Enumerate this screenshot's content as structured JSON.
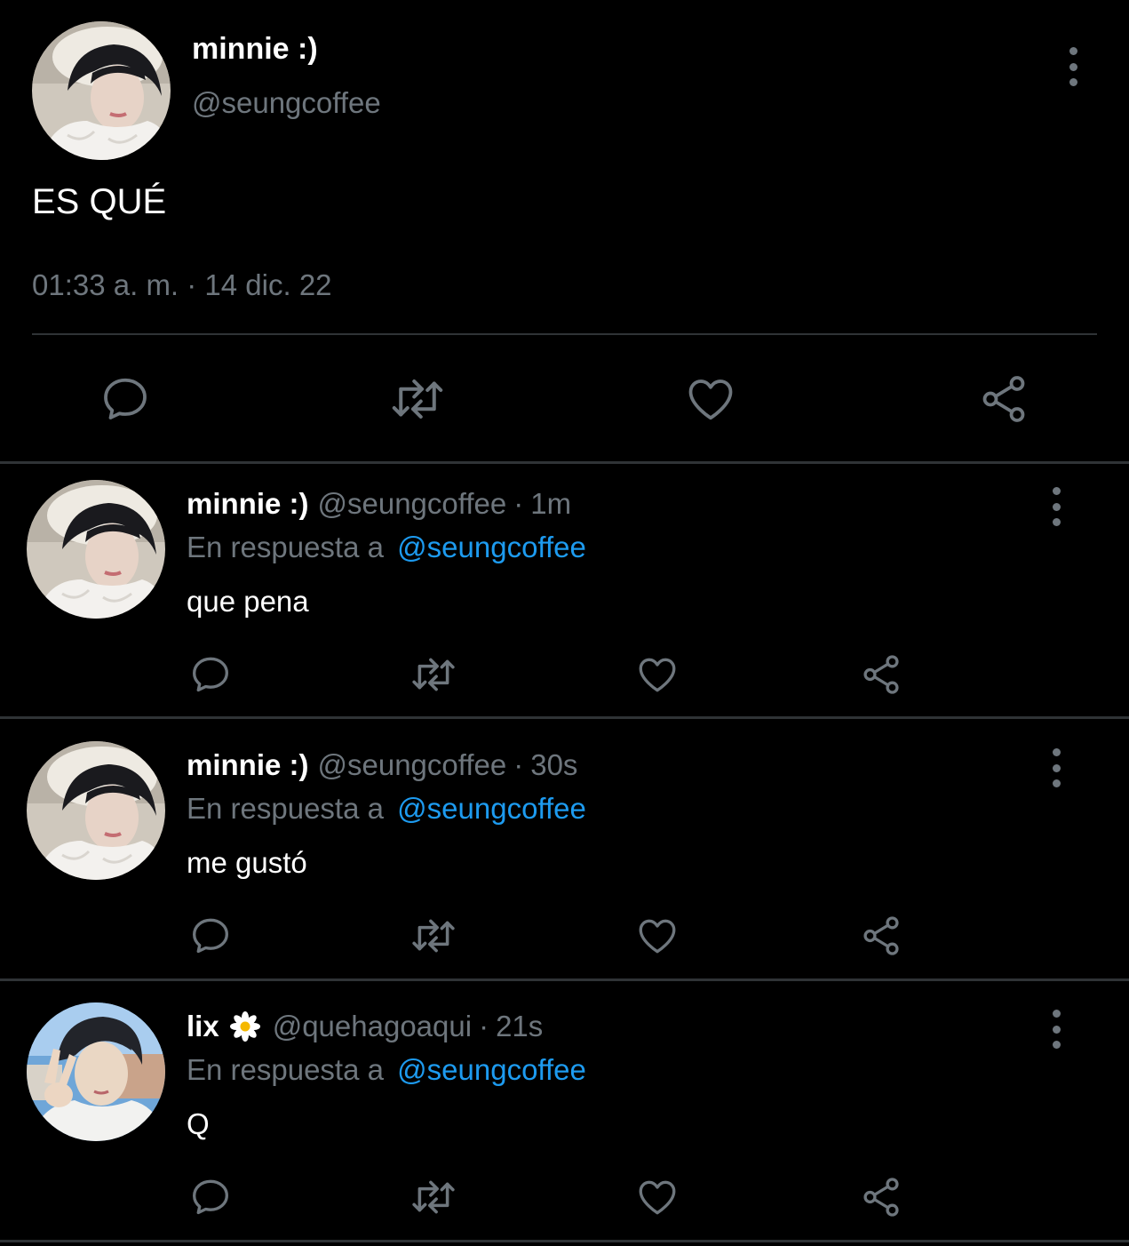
{
  "colors": {
    "background": "#000000",
    "divider": "#2f3336",
    "secondary_text": "#6e767d",
    "primary_text": "#ffffff",
    "link": "#1d9bf0"
  },
  "main_tweet": {
    "display_name": "minnie :)",
    "handle": "@seungcoffee",
    "text": "ES QUÉ",
    "timestamp": "01:33 a. m. · 14 dic. 22",
    "avatar_icon": "user-avatar-photo",
    "actions": [
      "reply-icon",
      "retweet-icon",
      "like-icon",
      "share-icon"
    ],
    "menu_icon": "more-vertical-icon"
  },
  "replies": [
    {
      "display_name": "minnie :)",
      "handle": "@seungcoffee",
      "separator": "·",
      "time": "1m",
      "reply_prefix": "En respuesta a",
      "reply_to": "@seungcoffee",
      "text": "que pena",
      "avatar_icon": "user-avatar-photo"
    },
    {
      "display_name": "minnie :)",
      "handle": "@seungcoffee",
      "separator": "·",
      "time": "30s",
      "reply_prefix": "En respuesta a",
      "reply_to": "@seungcoffee",
      "text": "me gustó",
      "avatar_icon": "user-avatar-photo"
    },
    {
      "display_name": "lix",
      "name_emoji": "daisy-icon",
      "handle": "@quehagoaqui",
      "separator": "·",
      "time": "21s",
      "reply_prefix": "En respuesta a",
      "reply_to": "@seungcoffee",
      "text": "Q",
      "avatar_icon": "user-avatar-photo"
    }
  ]
}
